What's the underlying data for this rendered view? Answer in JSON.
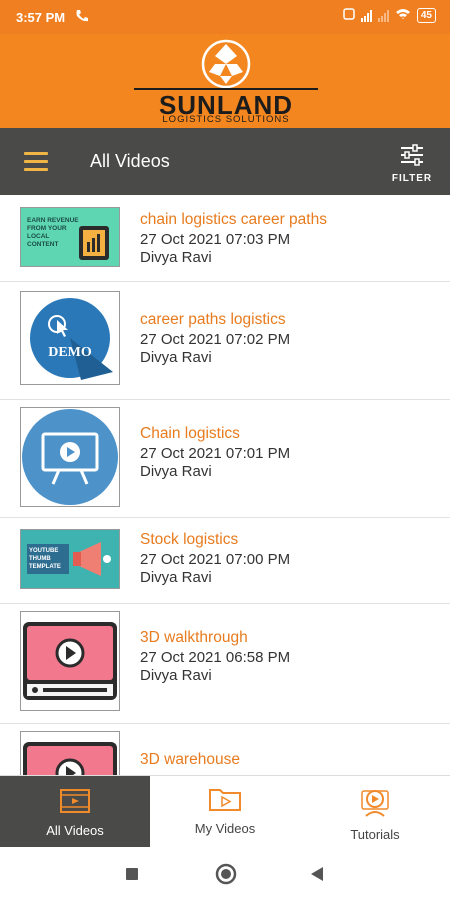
{
  "status": {
    "time": "3:57 PM",
    "battery": "45"
  },
  "brand": {
    "name": "SUNLAND",
    "tagline": "LOGISTICS SOLUTIONS"
  },
  "toolbar": {
    "title": "All Videos",
    "filter_label": "FILTER"
  },
  "videos": [
    {
      "title": "chain logistics career paths",
      "date": "27 Oct 2021 07:03 PM",
      "author": "Divya Ravi",
      "thumb_text": "EARN REVENUE FROM YOUR LOCAL CONTENT"
    },
    {
      "title": "career paths logistics",
      "date": "27 Oct 2021 07:02 PM",
      "author": "Divya Ravi",
      "thumb_text": "DEMO"
    },
    {
      "title": "Chain logistics",
      "date": "27 Oct 2021 07:01 PM",
      "author": "Divya Ravi"
    },
    {
      "title": "Stock logistics",
      "date": "27 Oct 2021 07:00 PM",
      "author": "Divya Ravi",
      "thumb_text": "YOUTUBE THUMB TEMPLATE"
    },
    {
      "title": "3D walkthrough",
      "date": "27 Oct 2021 06:58 PM",
      "author": "Divya Ravi"
    },
    {
      "title": "3D warehouse"
    }
  ],
  "bottom_nav": [
    {
      "label": "All Videos",
      "active": true
    },
    {
      "label": "My Videos",
      "active": false
    },
    {
      "label": "Tutorials",
      "active": false
    }
  ],
  "colors": {
    "accent": "#f3861f",
    "toolbar": "#4a4a48",
    "title_text": "#e87b1e"
  },
  "icons": [
    "hamburger-menu-icon",
    "filter-sliders-icon",
    "film-strip-icon",
    "folder-play-icon",
    "video-tutorial-icon"
  ]
}
